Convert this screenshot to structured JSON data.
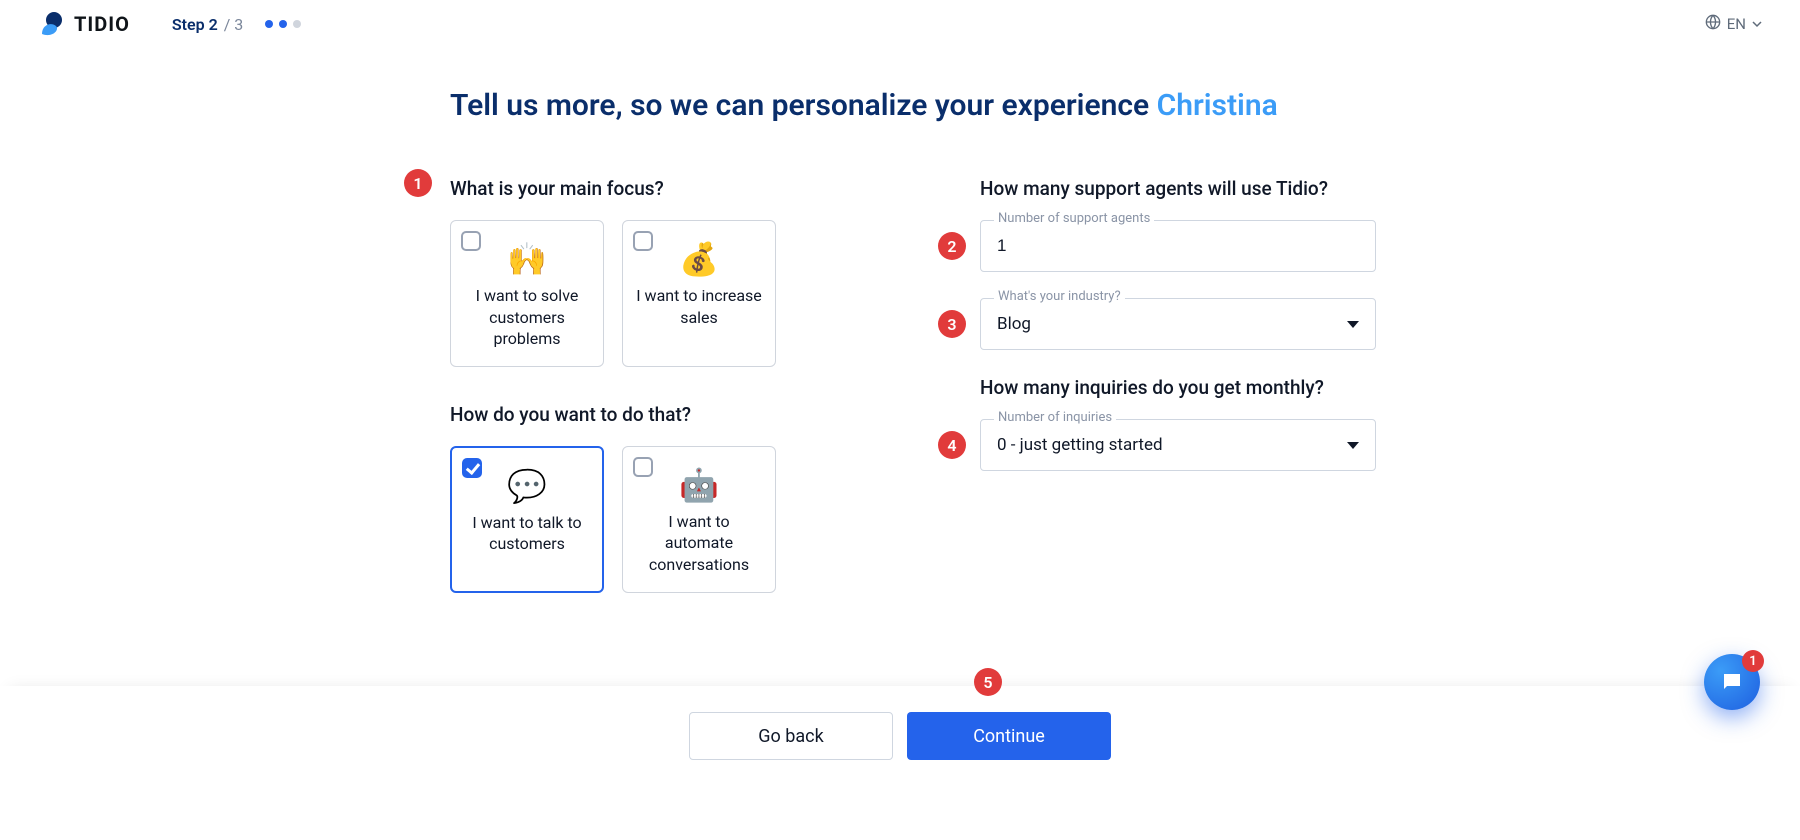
{
  "header": {
    "brand": "TIDIO",
    "step_label": "Step 2",
    "step_separator": " / 3",
    "lang": "EN"
  },
  "headline": {
    "prefix": "Tell us more, so we can personalize your experience ",
    "username": "Christina"
  },
  "left": {
    "q1_label": "What is your main focus?",
    "q1_options": [
      {
        "emoji": "🙌",
        "text": "I want to solve customers problems"
      },
      {
        "emoji": "💰",
        "text": "I want to increase sales"
      }
    ],
    "q2_label": "How do you want to do that?",
    "q2_options": [
      {
        "emoji": "💬",
        "text": "I want to talk to customers",
        "selected": true
      },
      {
        "emoji": "🤖",
        "text": "I want to automate conversations"
      }
    ]
  },
  "right": {
    "q_agents_label": "How many support agents will use Tidio?",
    "agents_field_label": "Number of support agents",
    "agents_value": "1",
    "industry_field_label": "What's your industry?",
    "industry_value": "Blog",
    "q_inquiries_label": "How many inquiries do you get monthly?",
    "inquiries_field_label": "Number of inquiries",
    "inquiries_value": "0 - just getting started"
  },
  "badges": {
    "b1": "1",
    "b2": "2",
    "b3": "3",
    "b4": "4",
    "b5": "5"
  },
  "footer": {
    "back_label": "Go back",
    "continue_label": "Continue"
  },
  "chat": {
    "unread": "1"
  }
}
